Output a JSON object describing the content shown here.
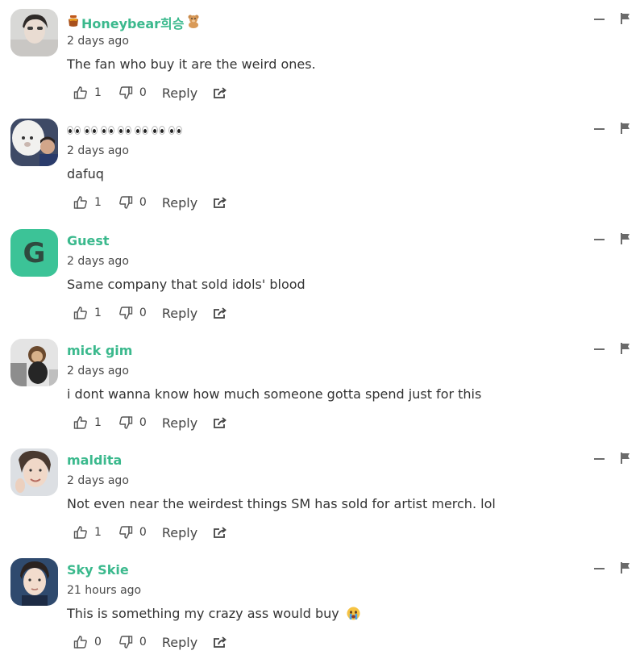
{
  "colors": {
    "author": "#3bb98d",
    "guest_avatar_bg": "#3cc397",
    "icon": "#6b6b6b"
  },
  "comments": [
    {
      "author_prefix_icon": "honey-pot-icon",
      "author": "Honeybear희승",
      "author_suffix_icon": "teddy-bear-icon",
      "time": "2 days ago",
      "text": "The fan who buy it are the weird ones.",
      "likes": "1",
      "dislikes": "0",
      "reply_label": "Reply",
      "text_emoji": ""
    },
    {
      "author_icons": [
        "eyes-emoji",
        "eyes-emoji",
        "eyes-emoji",
        "eyes-emoji",
        "eyes-emoji",
        "eyes-emoji",
        "eyes-emoji"
      ],
      "time": "2 days ago",
      "text": "dafuq",
      "likes": "1",
      "dislikes": "0",
      "reply_label": "Reply"
    },
    {
      "avatar_letter": "G",
      "author": "Guest",
      "time": "2 days ago",
      "text": "Same company that sold idols' blood",
      "likes": "1",
      "dislikes": "0",
      "reply_label": "Reply"
    },
    {
      "author": "mick gim",
      "time": "2 days ago",
      "text": "i dont wanna know how much someone gotta spend just for this",
      "likes": "1",
      "dislikes": "0",
      "reply_label": "Reply"
    },
    {
      "author": "maldita",
      "time": "2 days ago",
      "text": "Not even near the weirdest things SM has sold for artist merch. lol",
      "likes": "1",
      "dislikes": "0",
      "reply_label": "Reply"
    },
    {
      "author": "Sky Skie",
      "time": "21 hours ago",
      "text": "This is something my crazy ass would buy",
      "text_emoji": "crying-face-emoji",
      "likes": "0",
      "dislikes": "0",
      "reply_label": "Reply"
    }
  ]
}
